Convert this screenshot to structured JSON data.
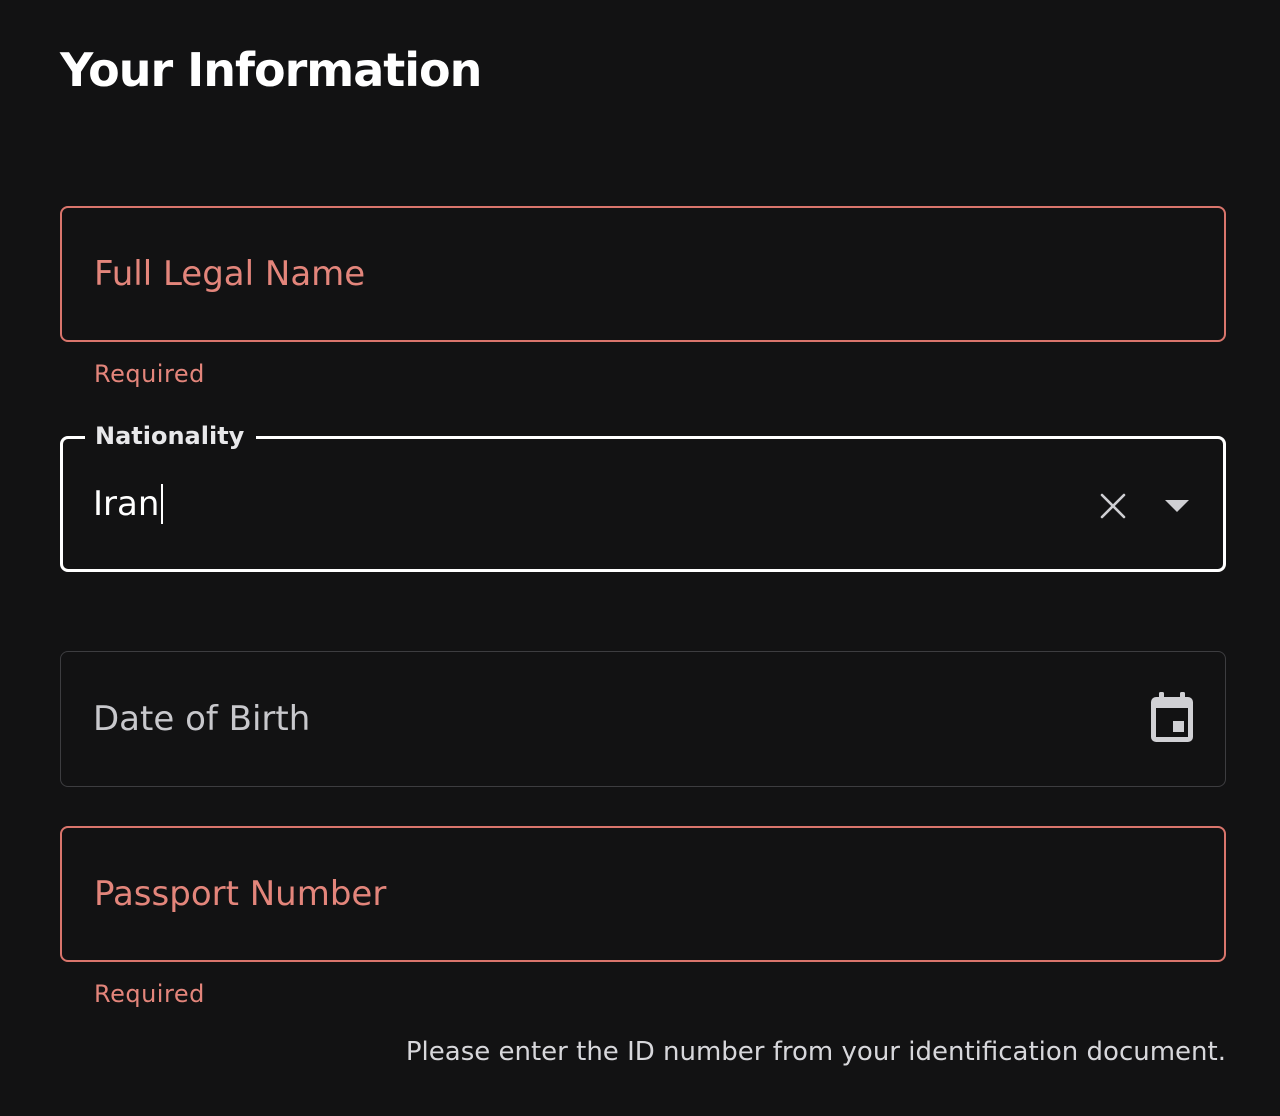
{
  "page": {
    "title": "Your Information"
  },
  "fields": {
    "full_name": {
      "placeholder": "Full Legal Name",
      "helper": "Required"
    },
    "nationality": {
      "label": "Nationality",
      "value": "Iran"
    },
    "date_of_birth": {
      "placeholder": "Date of Birth"
    },
    "passport_number": {
      "placeholder": "Passport Number",
      "helper": "Required",
      "hint": "Please enter the ID number from your identification document."
    }
  },
  "icons": {
    "clear": "close-icon",
    "dropdown": "chevron-down-icon",
    "calendar": "calendar-icon"
  },
  "colors": {
    "background": "#121213",
    "error": "#e3857b",
    "focus_border": "#ffffff",
    "default_border": "#3d3d40"
  }
}
